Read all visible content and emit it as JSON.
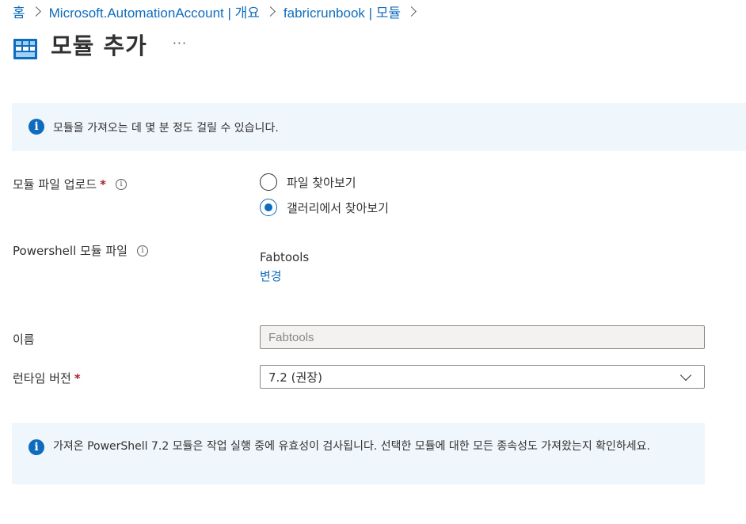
{
  "breadcrumb": {
    "items": [
      "홈",
      "Microsoft.AutomationAccount | 개요",
      "fabricrunbook | 모듈"
    ]
  },
  "header": {
    "icon": "modules-icon",
    "title": "모듈 추가",
    "more": "···"
  },
  "info_top": {
    "icon": "info-icon",
    "text": "모듈을 가져오는 데 몇 분 정도 걸릴 수 있습니다."
  },
  "form": {
    "upload": {
      "label": "모듈 파일 업로드",
      "required_mark": "*",
      "options": [
        {
          "label": "파일 찾아보기",
          "selected": false
        },
        {
          "label": "갤러리에서 찾아보기",
          "selected": true
        }
      ]
    },
    "module_file": {
      "label": "Powershell 모듈 파일",
      "value": "Fabtools",
      "change_link": "변경"
    },
    "name": {
      "label": "이름",
      "value": "Fabtools"
    },
    "runtime": {
      "label": "런타임 버전",
      "required_mark": "*",
      "selected": "7.2 (권장)"
    }
  },
  "info_bottom": {
    "icon": "info-icon",
    "text": "가져온 PowerShell 7.2 모듈은 작업 실행 중에 유효성이 검사됩니다. 선택한 모듈에 대한 모든 종속성도 가져왔는지 확인하세요."
  },
  "colors": {
    "accent": "#0f6cbd",
    "banner_bg": "#eff6fc",
    "required": "#a4262c"
  }
}
